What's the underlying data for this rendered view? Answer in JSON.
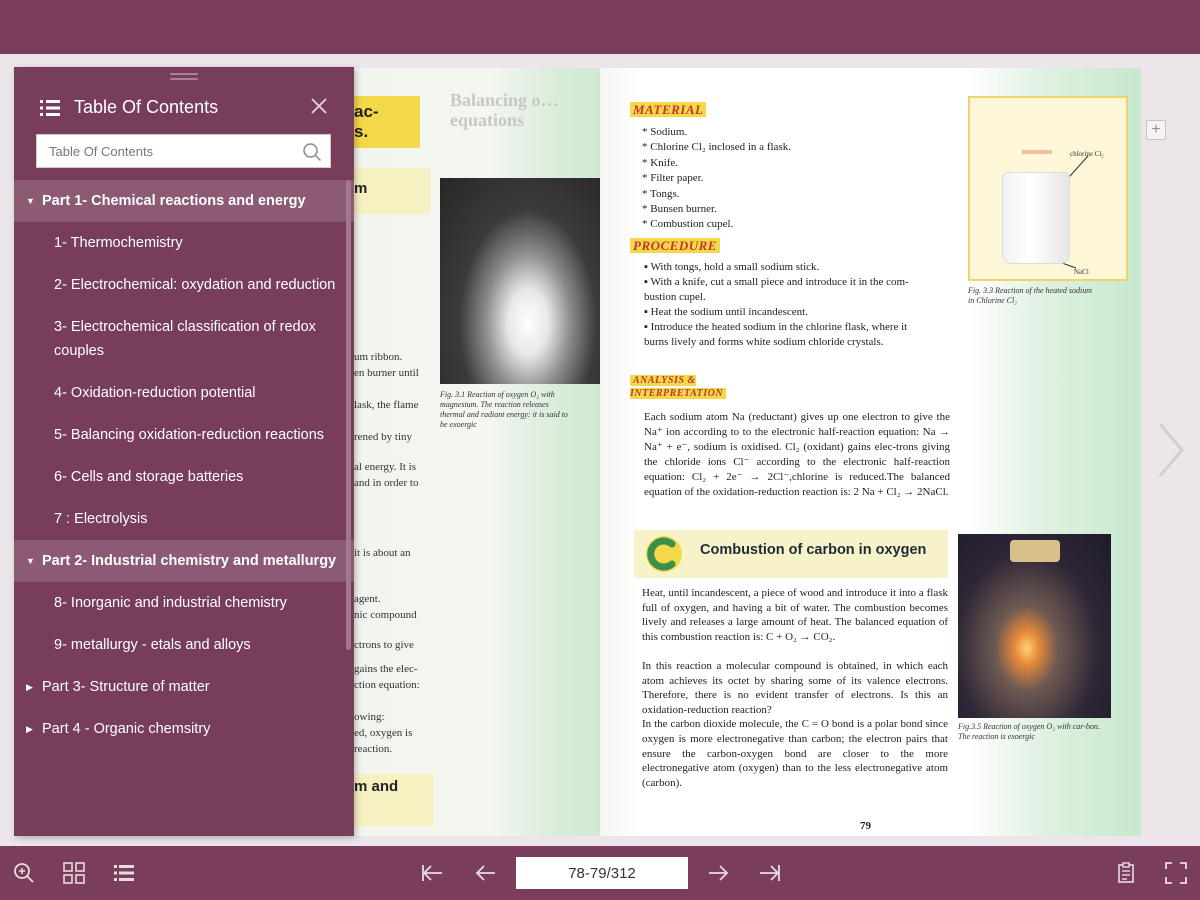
{
  "toc": {
    "title": "Table Of Contents",
    "search_placeholder": "Table Of Contents",
    "parts": [
      {
        "label": "Part 1- Chemical reactions and energy",
        "expanded": true,
        "items": [
          "1- Thermochemistry",
          "2- Electrochemical: oxydation and reduction",
          "3- Electrochemical classification of redox couples",
          "4- Oxidation-reduction potential",
          "5- Balancing oxidation-reduction reactions",
          "6- Cells and storage batteries",
          "7 : Electrolysis"
        ]
      },
      {
        "label": "Part 2- Industrial chemistry and metallurgy",
        "expanded": true,
        "items": [
          "8- Inorganic and industrial chemistry",
          "9- metallurgy - etals and alloys"
        ]
      },
      {
        "label": "Part 3- Structure of matter",
        "expanded": false,
        "items": []
      },
      {
        "label": "Part 4 - Organic chemsitry",
        "expanded": false,
        "items": []
      }
    ]
  },
  "toolbar": {
    "page_indicator": "78-79/312",
    "left_icons": [
      "zoom-in-icon",
      "thumbnails-grid-icon",
      "toc-list-icon"
    ],
    "nav_icons": [
      "first-page-icon",
      "previous-page-icon",
      "next-page-icon",
      "last-page-icon"
    ],
    "right_icons": [
      "bookmark-notes-icon",
      "fullscreen-icon"
    ]
  },
  "book": {
    "left_page": {
      "heading_fragment": "ac-\ns.",
      "ghost_heading": "Balancing o…\nequations",
      "sub_fragment": "m",
      "bottom_fragment": "m and",
      "photo_caption": "Fig. 3.1 Reaction of oxygen O₂ with magnesium. The reaction releases thermal and radiant energy: it is said to be exoergic",
      "text_fragments": [
        "um ribbon.",
        "en burner until",
        "lask, the flame",
        "rened by tiny",
        "al energy. It is",
        "and in order to",
        "it is about an",
        "agent.",
        "nic compound",
        "ctrons to give",
        "gains the elec-",
        "ction equation:",
        "owing:",
        "ed, oxygen is",
        "reaction."
      ]
    },
    "right_page": {
      "material_label": "MATERIAL",
      "materials": [
        "* Sodium.",
        "* Chlorine Cl₂ inclosed in a flask.",
        "* Knife.",
        "* Filter paper.",
        "* Tongs.",
        "* Bunsen burner.",
        "* Combustion cupel."
      ],
      "procedure_label": "PROCEDURE",
      "procedure": [
        "▪ With tongs, hold a small sodium stick.",
        "▪ With a knife, cut a small piece and introduce it in the com-\nbustion cupel.",
        "▪ Heat the sodium until incandescent.",
        "▪ Introduce the heated sodium in the chlorine flask, where it\nburns lively and forms white sodium chloride crystals."
      ],
      "analysis_label": "ANALYSIS & INTERPRETATION",
      "analysis_text": "Each sodium atom Na (reductant) gives up one electron to give the Na⁺ ion according to to the electronic half-reaction equation: Na → Na⁺ + e⁻, sodium is oxidised. Cl₂ (oxidant) gains elec-trons giving the chloride ions Cl⁻ according to the electronic half-reaction equation: Cl₂ + 2e⁻ → 2Cl⁻,chlorine is reduced.The balanced equation of the oxidation-reduction reaction is: 2 Na + Cl₂ → 2NaCl.",
      "fig_label_chlorine": "chlorine Cl₂",
      "fig_label_nacl": "NaCl",
      "fig_caption": "Fig. 3.3 Reaction of the heated sodium in Chlorine Cl₂",
      "combustion_title": "Combustion of carbon in oxygen",
      "combustion_text": "Heat, until incandescent, a piece of wood and introduce it into a flask full of oxygen, and having a bit of water. The combustion becomes lively and releases a large amount of heat. The balanced equation of this combustion reaction is: C + O₂ → CO₂.\n\nIn this reaction a molecular compound is obtained, in which each atom achieves its octet by sharing some of its valence electrons. Therefore, there is no evident transfer of electrons. Is this an oxidation-reduction reaction?\n  In the carbon dioxide molecule, the C = O bond is a polar bond since oxygen is more electronegative than carbon; the electron pairs that ensure the carbon-oxygen bond are closer to the more electronegative atom (oxygen) than to the less electronegative atom (carbon).",
      "combustion_caption": "Fig.3.5 Reaction of oxygen O₂ with car-bon. The reaction is exoergic",
      "page_number": "79"
    }
  },
  "colors": {
    "brand": "#7a3d5c",
    "toc_bg": "#773d5a",
    "toc_active": "#8c5a73",
    "accent_yellow": "#f5d84a"
  }
}
